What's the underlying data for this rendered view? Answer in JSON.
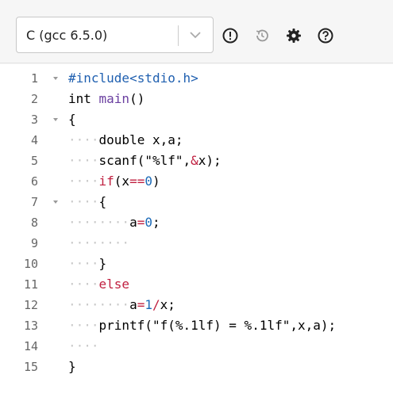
{
  "toolbar": {
    "language_select": {
      "value": "C (gcc 6.5.0)"
    },
    "icons": [
      "info-icon",
      "history-icon",
      "settings-gear-icon",
      "help-icon"
    ]
  },
  "editor": {
    "lines": [
      {
        "num": "1",
        "fold": true,
        "tokens": [
          {
            "t": "#include<stdio.h>",
            "c": "pre"
          }
        ]
      },
      {
        "num": "2",
        "fold": false,
        "tokens": [
          {
            "t": "int ",
            "c": "kw"
          },
          {
            "t": "main",
            "c": "fn"
          },
          {
            "t": "()",
            "c": "kw"
          }
        ]
      },
      {
        "num": "3",
        "fold": true,
        "tokens": [
          {
            "t": "{",
            "c": "kw"
          }
        ]
      },
      {
        "num": "4",
        "fold": false,
        "tokens": [
          {
            "t": "····",
            "c": "dots"
          },
          {
            "t": "double x,a;",
            "c": "kw"
          }
        ]
      },
      {
        "num": "5",
        "fold": false,
        "tokens": [
          {
            "t": "····",
            "c": "dots"
          },
          {
            "t": "scanf(\"%lf\",",
            "c": "kw"
          },
          {
            "t": "&",
            "c": "op"
          },
          {
            "t": "x);",
            "c": "kw"
          }
        ]
      },
      {
        "num": "6",
        "fold": false,
        "tokens": [
          {
            "t": "····",
            "c": "dots"
          },
          {
            "t": "if",
            "c": "ctl"
          },
          {
            "t": "(x",
            "c": "kw"
          },
          {
            "t": "==",
            "c": "op"
          },
          {
            "t": "0",
            "c": "num"
          },
          {
            "t": ")",
            "c": "kw"
          }
        ]
      },
      {
        "num": "7",
        "fold": true,
        "tokens": [
          {
            "t": "····",
            "c": "dots"
          },
          {
            "t": "{",
            "c": "kw"
          }
        ]
      },
      {
        "num": "8",
        "fold": false,
        "tokens": [
          {
            "t": "········",
            "c": "dots"
          },
          {
            "t": "a",
            "c": "kw"
          },
          {
            "t": "=",
            "c": "op"
          },
          {
            "t": "0",
            "c": "num"
          },
          {
            "t": ";",
            "c": "kw"
          }
        ]
      },
      {
        "num": "9",
        "fold": false,
        "tokens": [
          {
            "t": "········",
            "c": "dots"
          }
        ]
      },
      {
        "num": "10",
        "fold": false,
        "tokens": [
          {
            "t": "····",
            "c": "dots"
          },
          {
            "t": "}",
            "c": "kw"
          }
        ]
      },
      {
        "num": "11",
        "fold": false,
        "tokens": [
          {
            "t": "····",
            "c": "dots"
          },
          {
            "t": "else",
            "c": "ctl"
          }
        ]
      },
      {
        "num": "12",
        "fold": false,
        "tokens": [
          {
            "t": "········",
            "c": "dots"
          },
          {
            "t": "a",
            "c": "kw"
          },
          {
            "t": "=",
            "c": "op"
          },
          {
            "t": "1",
            "c": "num"
          },
          {
            "t": "/",
            "c": "op"
          },
          {
            "t": "x;",
            "c": "kw"
          }
        ]
      },
      {
        "num": "13",
        "fold": false,
        "tokens": [
          {
            "t": "····",
            "c": "dots"
          },
          {
            "t": "printf(\"f(%.1lf) = %.1lf\",x,a);",
            "c": "kw"
          }
        ]
      },
      {
        "num": "14",
        "fold": false,
        "tokens": [
          {
            "t": "····",
            "c": "dots"
          }
        ]
      },
      {
        "num": "15",
        "fold": false,
        "tokens": [
          {
            "t": "}",
            "c": "kw"
          }
        ]
      }
    ]
  },
  "colors": {
    "preprocessor": "#2060b0",
    "function": "#6a3fa0",
    "control": "#c02040",
    "number": "#1a6ab8",
    "whitespace_dots": "#c8c8c8"
  }
}
